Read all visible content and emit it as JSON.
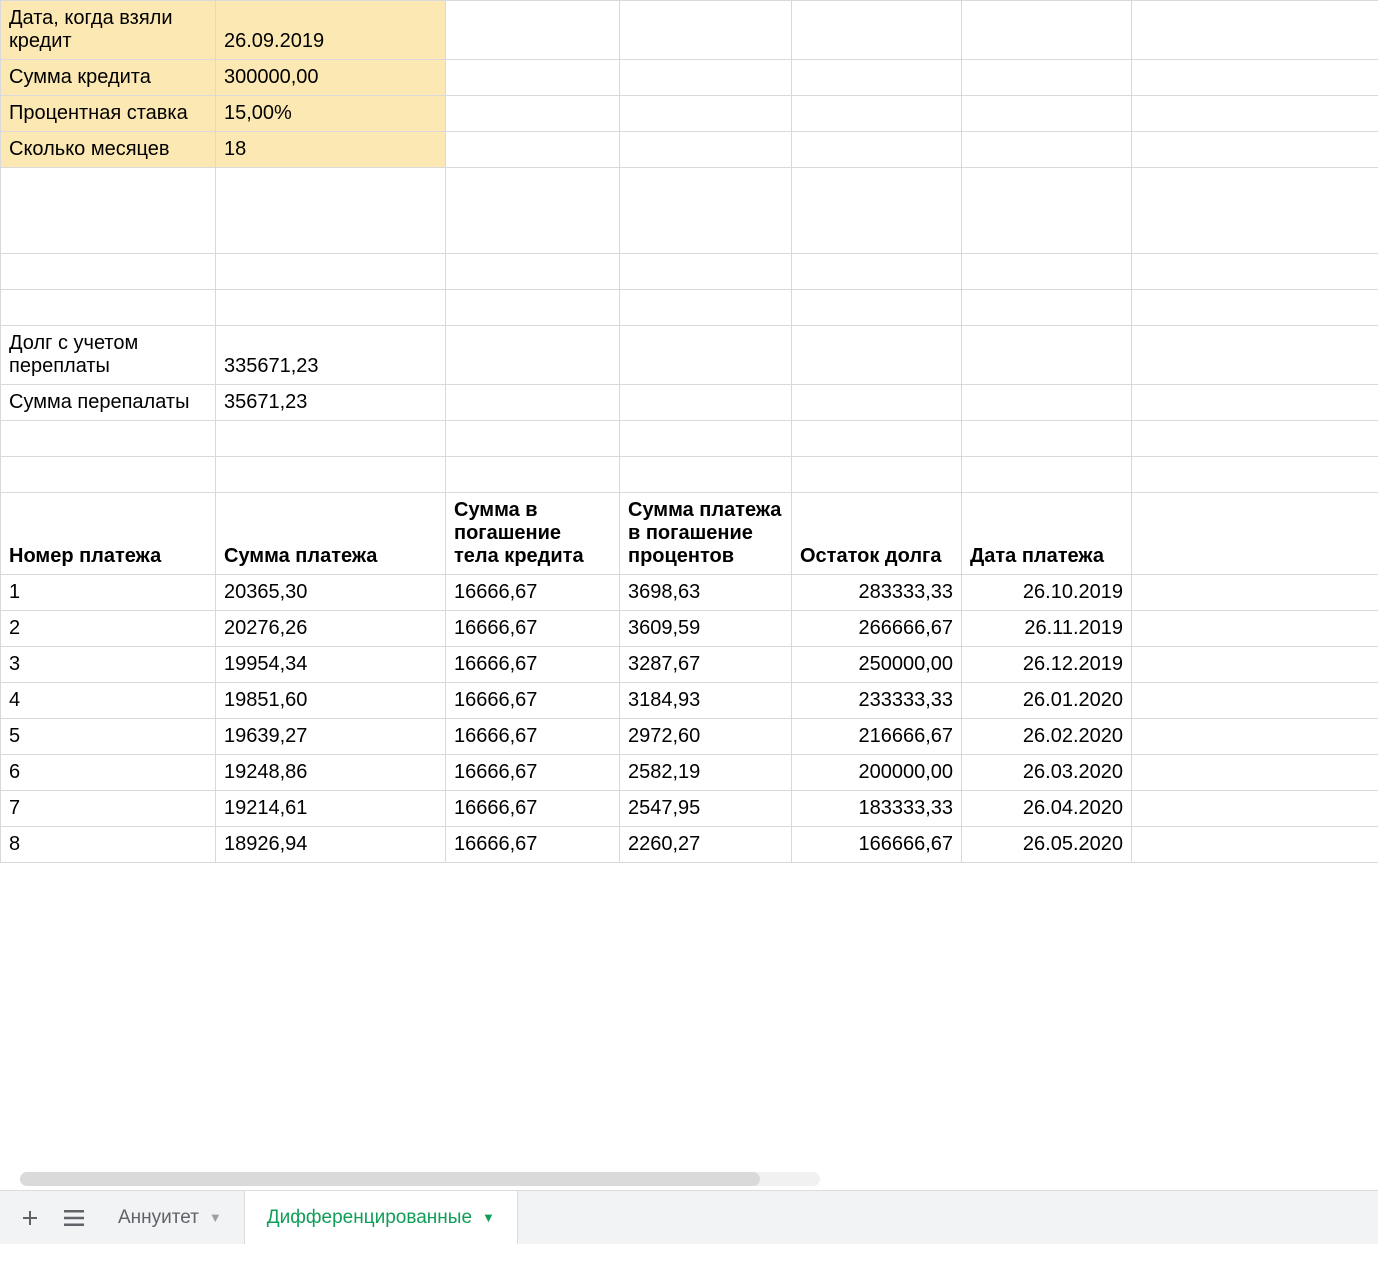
{
  "params": {
    "date_label": "Дата, когда взяли кредит",
    "date_value": "26.09.2019",
    "amount_label": "Сумма кредита",
    "amount_value": "300000,00",
    "rate_label": "Процентная ставка",
    "rate_value": "15,00%",
    "months_label": "Сколько месяцев",
    "months_value": "18"
  },
  "summary": {
    "total_debt_label": "Долг с учетом переплаты",
    "total_debt_value": "335671,23",
    "overpay_label": "Сумма перепалаты",
    "overpay_value": "35671,23"
  },
  "headers": {
    "num": "Номер платежа",
    "payment": "Сумма платежа",
    "principal": "Сумма в погашение тела кредита",
    "interest": "Сумма платежа в погашение процентов",
    "balance": "Остаток долга",
    "date": "Дата платежа"
  },
  "rows": [
    {
      "num": "1",
      "payment": "20365,30",
      "principal": "16666,67",
      "interest": "3698,63",
      "balance": "283333,33",
      "date": "26.10.2019"
    },
    {
      "num": "2",
      "payment": "20276,26",
      "principal": "16666,67",
      "interest": "3609,59",
      "balance": "266666,67",
      "date": "26.11.2019"
    },
    {
      "num": "3",
      "payment": "19954,34",
      "principal": "16666,67",
      "interest": "3287,67",
      "balance": "250000,00",
      "date": "26.12.2019"
    },
    {
      "num": "4",
      "payment": "19851,60",
      "principal": "16666,67",
      "interest": "3184,93",
      "balance": "233333,33",
      "date": "26.01.2020"
    },
    {
      "num": "5",
      "payment": "19639,27",
      "principal": "16666,67",
      "interest": "2972,60",
      "balance": "216666,67",
      "date": "26.02.2020"
    },
    {
      "num": "6",
      "payment": "19248,86",
      "principal": "16666,67",
      "interest": "2582,19",
      "balance": "200000,00",
      "date": "26.03.2020"
    },
    {
      "num": "7",
      "payment": "19214,61",
      "principal": "16666,67",
      "interest": "2547,95",
      "balance": "183333,33",
      "date": "26.04.2020"
    },
    {
      "num": "8",
      "payment": "18926,94",
      "principal": "16666,67",
      "interest": "2260,27",
      "balance": "166666,67",
      "date": "26.05.2020"
    }
  ],
  "tabs": {
    "tab1": "Аннуитет",
    "tab2": "Дифференцированные"
  }
}
